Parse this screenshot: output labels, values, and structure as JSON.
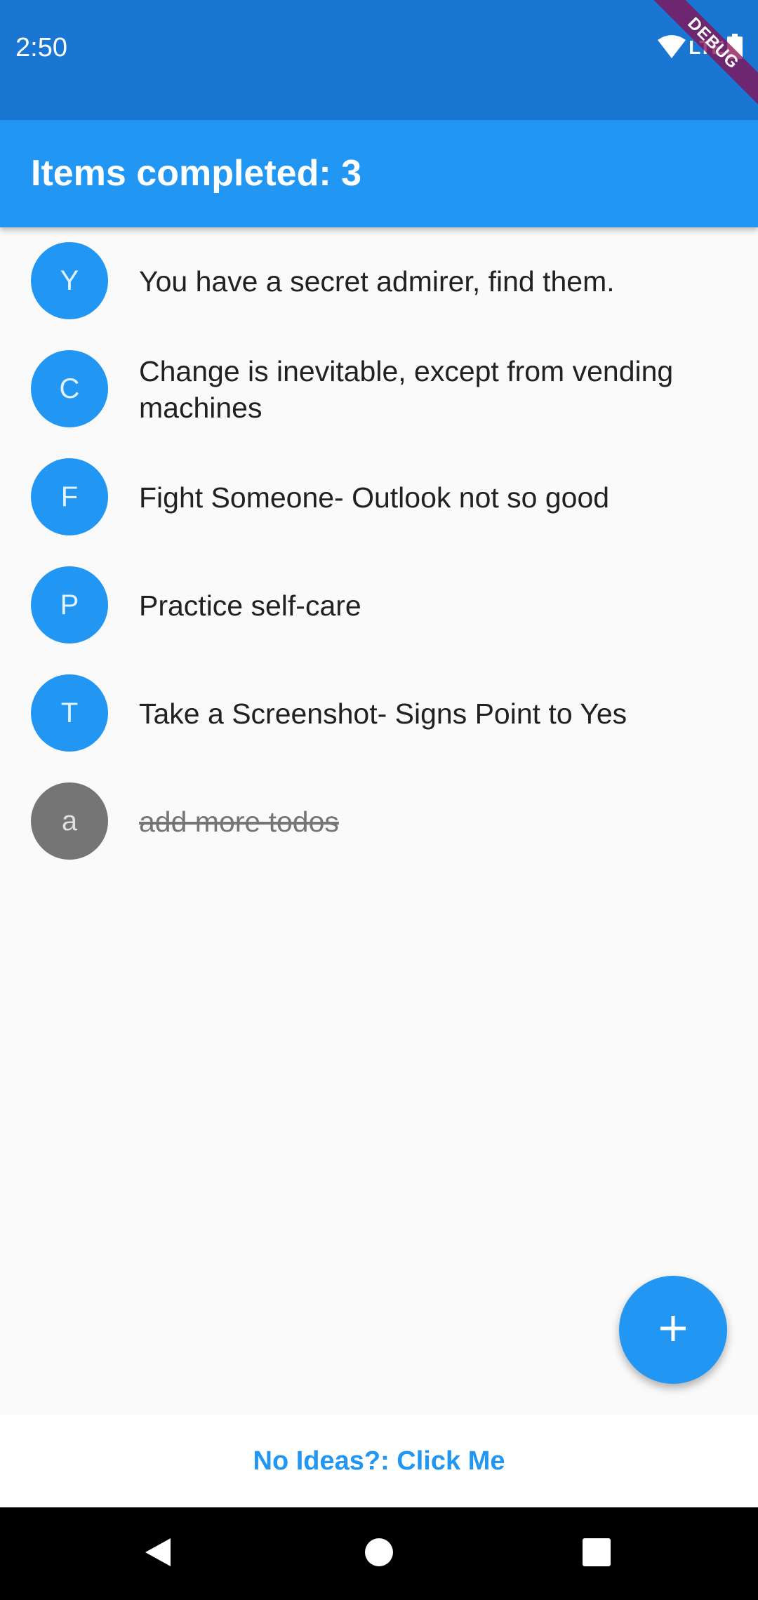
{
  "status_bar": {
    "time": "2:50",
    "network_label": "LTE",
    "icons": [
      "wifi-icon",
      "battery-icon"
    ]
  },
  "debug_banner": {
    "label": "DEBUG"
  },
  "app_bar": {
    "title": "Items completed: 3"
  },
  "todos": [
    {
      "initial": "Y",
      "text": "You have a secret admirer, find them.",
      "completed": false
    },
    {
      "initial": "C",
      "text": "Change is inevitable, except from vending machines",
      "completed": false
    },
    {
      "initial": "F",
      "text": "Fight Someone- Outlook not so good",
      "completed": false
    },
    {
      "initial": "P",
      "text": "Practice self-care",
      "completed": false
    },
    {
      "initial": "T",
      "text": "Take a Screenshot- Signs Point to Yes",
      "completed": false
    },
    {
      "initial": "a",
      "text": "add more todos",
      "completed": true
    }
  ],
  "fab": {
    "icon": "plus-icon"
  },
  "bottom_bar": {
    "button_label": "No Ideas?: Click Me"
  },
  "nav_bar": {
    "icons": [
      "back-icon",
      "home-icon",
      "recents-icon"
    ]
  },
  "colors": {
    "primary": "#2196f3",
    "primary_dark": "#1976d2",
    "completed": "#757575",
    "debug": "#880e4f"
  }
}
